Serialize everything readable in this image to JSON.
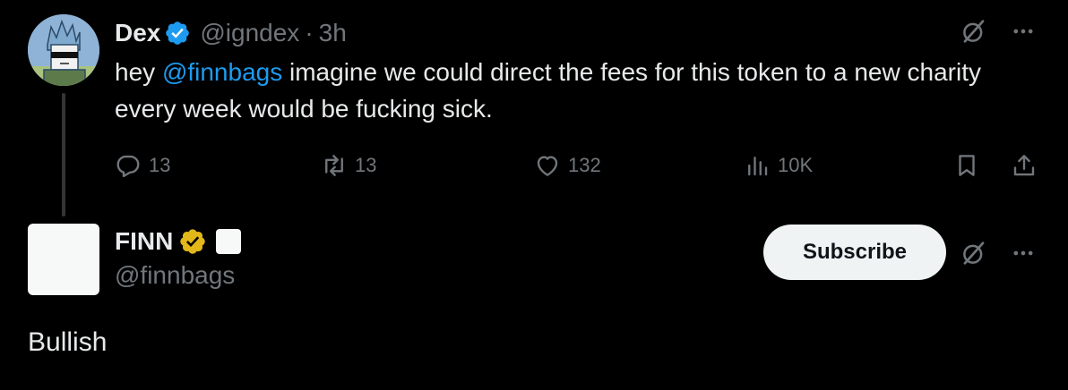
{
  "reply_parent": {
    "author_name": "Dex",
    "author_handle": "@igndex",
    "separator": "·",
    "time": "3h",
    "text_prefix": "hey ",
    "mention": "@finnbags",
    "text_suffix": " imagine we could direct the fees for this token to a new charity every week would be fucking sick.",
    "actions": {
      "replies": "13",
      "reposts": "13",
      "likes": "132",
      "views": "10K"
    },
    "icons": [
      "verified-badge-icon",
      "grok-icon",
      "more-icon",
      "reply-icon",
      "repost-icon",
      "like-icon",
      "views-icon",
      "bookmark-icon",
      "share-icon"
    ]
  },
  "reply": {
    "author_name": "FINN",
    "author_handle": "@finnbags",
    "subscribe_label": "Subscribe",
    "text": "Bullish",
    "icons": [
      "gold-verified-badge-icon",
      "grok-icon",
      "more-icon"
    ]
  },
  "colors": {
    "background": "#000000",
    "text_primary": "#e7e9ea",
    "text_secondary": "#71767b",
    "accent_blue": "#1d9bf0",
    "gold_badge": "#e2b719",
    "button_bg": "#eff3f4"
  }
}
